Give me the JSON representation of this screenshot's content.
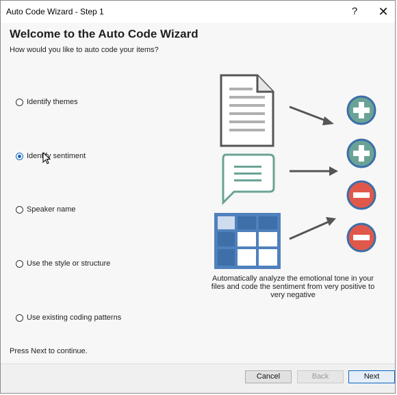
{
  "window": {
    "title": "Auto Code Wizard - Step 1",
    "help_glyph": "?",
    "close_glyph": "✕"
  },
  "content": {
    "heading": "Welcome to the Auto Code Wizard",
    "subheading": "How would you like to auto code your items?",
    "options": [
      {
        "label": "Identify themes",
        "selected": false
      },
      {
        "label": "Identify sentiment",
        "selected": true
      },
      {
        "label": "Speaker name",
        "selected": false
      },
      {
        "label": "Use the style or structure",
        "selected": false
      },
      {
        "label": "Use existing coding patterns",
        "selected": false
      }
    ],
    "description": "Automatically analyze the emotional tone in your files and code the sentiment from very positive to very negative",
    "hint": "Press Next to continue."
  },
  "illustration": {
    "icons": [
      "document-icon",
      "chat-bubble-icon",
      "table-icon",
      "plus-circle-icon",
      "plus-circle-icon",
      "minus-circle-icon",
      "minus-circle-icon"
    ],
    "colors": {
      "positive": "#6aa395",
      "negative": "#e0584a",
      "ring": "#3c6ea8",
      "table": "#4f81bd",
      "chat": "#6aa395",
      "arrow": "#555555"
    }
  },
  "footer": {
    "cancel_label": "Cancel",
    "back_label": "Back",
    "next_label": "Next"
  }
}
